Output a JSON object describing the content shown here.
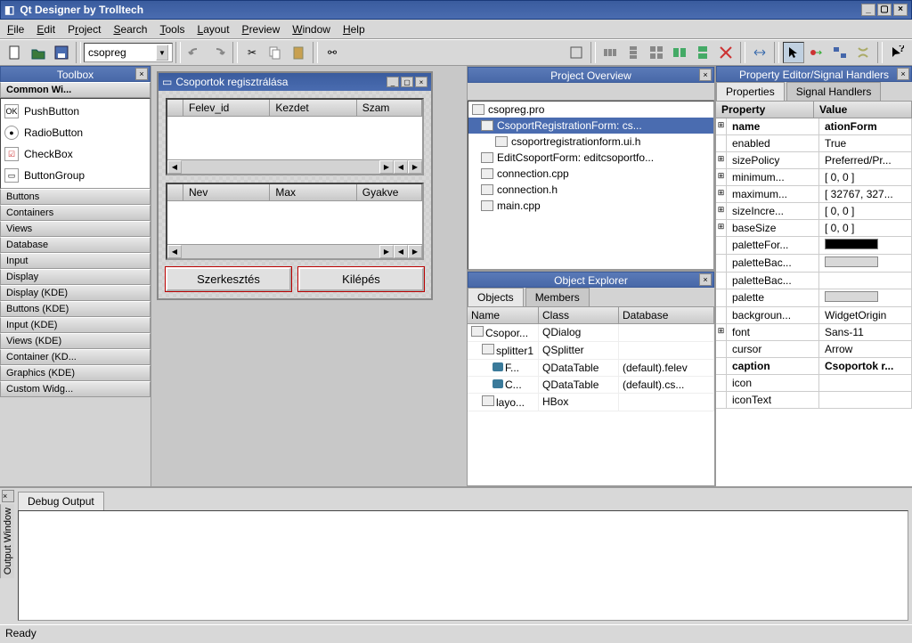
{
  "title": "Qt Designer by Trolltech",
  "menu": [
    "File",
    "Edit",
    "Project",
    "Search",
    "Tools",
    "Layout",
    "Preview",
    "Window",
    "Help"
  ],
  "project_combo": "csopreg",
  "toolbox": {
    "title": "Toolbox",
    "active_category": "Common Wi...",
    "items": [
      {
        "label": "PushButton",
        "icon": "OK"
      },
      {
        "label": "RadioButton",
        "icon": "●"
      },
      {
        "label": "CheckBox",
        "icon": "☑"
      },
      {
        "label": "ButtonGroup",
        "icon": "▭"
      }
    ],
    "categories": [
      "Buttons",
      "Containers",
      "Views",
      "Database",
      "Input",
      "Display",
      "Display (KDE)",
      "Buttons (KDE)",
      "Input (KDE)",
      "Views (KDE)",
      "Container (KD...",
      "Graphics (KDE)",
      "Custom Widg..."
    ]
  },
  "form": {
    "title": "Csoportok regisztrálása",
    "table1_cols": [
      "Felev_id",
      "Kezdet",
      "Szam"
    ],
    "table2_cols": [
      "Nev",
      "Max",
      "Gyakve"
    ],
    "btn_edit": "Szerkesztés",
    "btn_exit": "Kilépés"
  },
  "project_overview": {
    "title": "Project Overview",
    "root": "csopreg.pro",
    "items": [
      {
        "label": "CsoportRegistrationForm: cs...",
        "sel": true
      },
      {
        "label": "csoportregistrationform.ui.h",
        "indent": 1
      },
      {
        "label": "EditCsoportForm: editcsoportfo..."
      },
      {
        "label": "connection.cpp"
      },
      {
        "label": "connection.h"
      },
      {
        "label": "main.cpp"
      }
    ]
  },
  "object_explorer": {
    "title": "Object Explorer",
    "tabs": [
      "Objects",
      "Members"
    ],
    "cols": [
      "Name",
      "Class",
      "Database"
    ],
    "rows": [
      {
        "n": "Csopor...",
        "c": "QDialog",
        "d": ""
      },
      {
        "n": "splitter1",
        "c": "QSplitter",
        "d": "",
        "indent": 1
      },
      {
        "n": "F...",
        "c": "QDataTable",
        "d": "(default).felev",
        "indent": 2,
        "db": true
      },
      {
        "n": "C...",
        "c": "QDataTable",
        "d": "(default).cs...",
        "indent": 2,
        "db": true
      },
      {
        "n": "layo...",
        "c": "HBox",
        "d": "",
        "indent": 1
      }
    ]
  },
  "property_editor": {
    "title": "Property Editor/Signal Handlers",
    "tabs": [
      "Properties",
      "Signal Handlers"
    ],
    "head": [
      "Property",
      "Value"
    ],
    "rows": [
      {
        "p": "name",
        "v": "ationForm",
        "exp": "⊞",
        "bold": true
      },
      {
        "p": "enabled",
        "v": "True"
      },
      {
        "p": "sizePolicy",
        "v": "Preferred/Pr...",
        "exp": "⊞"
      },
      {
        "p": "minimum...",
        "v": "[ 0, 0 ]",
        "exp": "⊞"
      },
      {
        "p": "maximum...",
        "v": "[ 32767, 327...",
        "exp": "⊞"
      },
      {
        "p": "sizeIncre...",
        "v": "[ 0, 0 ]",
        "exp": "⊞"
      },
      {
        "p": "baseSize",
        "v": "[ 0, 0 ]",
        "exp": "⊞"
      },
      {
        "p": "paletteFor...",
        "v": "",
        "color": "#000"
      },
      {
        "p": "paletteBac...",
        "v": "",
        "color": "#d8d8d8"
      },
      {
        "p": "paletteBac...",
        "v": ""
      },
      {
        "p": "palette",
        "v": "",
        "color": "#d8d8d8"
      },
      {
        "p": "backgroun...",
        "v": "WidgetOrigin"
      },
      {
        "p": "font",
        "v": "Sans-11",
        "exp": "⊞"
      },
      {
        "p": "cursor",
        "v": "Arrow"
      },
      {
        "p": "caption",
        "v": "Csoportok r...",
        "bold": true
      },
      {
        "p": "icon",
        "v": ""
      },
      {
        "p": "iconText",
        "v": ""
      }
    ]
  },
  "output": {
    "label": "Output Window",
    "tab": "Debug Output"
  },
  "status": "Ready"
}
